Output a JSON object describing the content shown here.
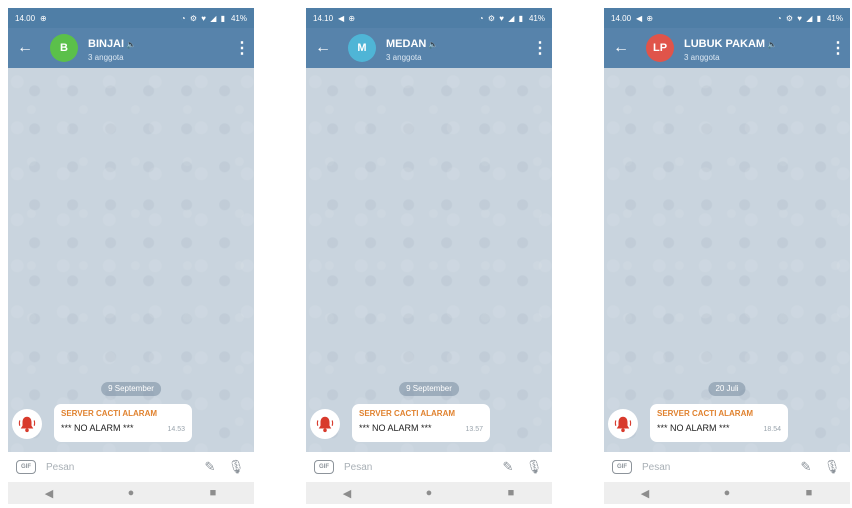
{
  "screens": [
    {
      "status": {
        "time": "14.00",
        "left_icons": "⊕",
        "right_icons": "◔ ⚙ ♥ ◢ ▮",
        "battery": "41%"
      },
      "chat": {
        "avatar_letter": "B",
        "avatar_color": "#5bc04a",
        "title": "BINJAI",
        "subtitle": "3 anggota"
      },
      "date_chip": "9 September",
      "message": {
        "sender": "SERVER CACTI ALARAM",
        "text": "*** NO ALARM ***",
        "time": "14.53"
      },
      "input": {
        "placeholder": "Pesan"
      }
    },
    {
      "status": {
        "time": "14.10",
        "left_icons": "◀ ⊕",
        "right_icons": "◔ ⚙ ♥ ◢ ▮",
        "battery": "41%"
      },
      "chat": {
        "avatar_letter": "M",
        "avatar_color": "#4fb5d6",
        "title": "MEDAN",
        "subtitle": "3 anggota"
      },
      "date_chip": "9 September",
      "message": {
        "sender": "SERVER CACTI ALARAM",
        "text": "*** NO ALARM ***",
        "time": "13.57"
      },
      "input": {
        "placeholder": "Pesan"
      }
    },
    {
      "status": {
        "time": "14.00",
        "left_icons": "◀ ⊕",
        "right_icons": "◔ ⚙ ♥ ◢ ▮",
        "battery": "41%"
      },
      "chat": {
        "avatar_letter": "LP",
        "avatar_color": "#e0544a",
        "title": "LUBUK PAKAM",
        "subtitle": "3 anggota"
      },
      "date_chip": "20 Juli",
      "message": {
        "sender": "SERVER CACTI ALARAM",
        "text": "*** NO ALARM ***",
        "time": "18.54"
      },
      "input": {
        "placeholder": "Pesan"
      }
    }
  ],
  "icons": {
    "back": "arrow-left",
    "menu": "vertical-dots",
    "gif": "GIF",
    "attach": "paperclip",
    "mic": "microphone",
    "nav_back": "triangle-left",
    "nav_home": "circle",
    "nav_recent": "square"
  }
}
